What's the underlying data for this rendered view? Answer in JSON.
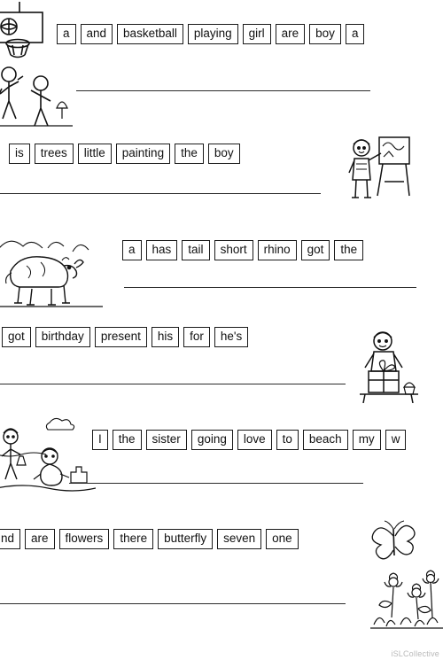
{
  "worksheet": {
    "watermark": "iSLCollective",
    "exercises": [
      {
        "id": "ex1",
        "words": [
          "a",
          "and",
          "basketball",
          "playing",
          "girl",
          "are",
          "boy",
          "a"
        ],
        "image": "basketball-hoop-children-playing"
      },
      {
        "id": "ex2",
        "words": [
          "is",
          "trees",
          "little",
          "painting",
          "the",
          "boy"
        ],
        "image": "boy-painting-at-easel"
      },
      {
        "id": "ex3",
        "words": [
          "a",
          "has",
          "tail",
          "short",
          "rhino",
          "got",
          "the"
        ],
        "image": "rhinoceros-in-landscape"
      },
      {
        "id": "ex4",
        "words": [
          "got",
          "birthday",
          "present",
          "his",
          "for",
          "he's"
        ],
        "image": "child-with-birthday-present"
      },
      {
        "id": "ex5",
        "words": [
          "I",
          "the",
          "sister",
          "going",
          "love",
          "to",
          "beach",
          "my",
          "w"
        ],
        "image": "children-playing-on-beach"
      },
      {
        "id": "ex6",
        "words": [
          "nd",
          "are",
          "flowers",
          "there",
          "butterfly",
          "seven",
          "one"
        ],
        "image": "butterfly-over-flowers"
      }
    ]
  }
}
